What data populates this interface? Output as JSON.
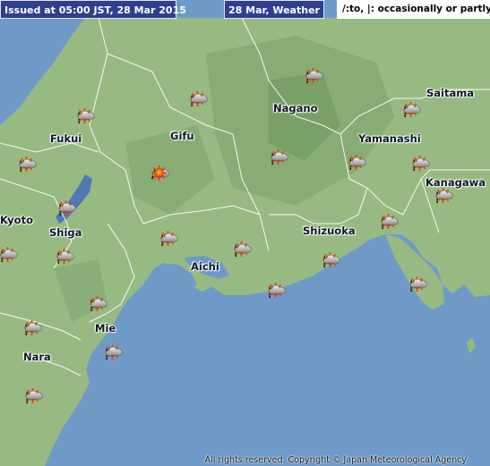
{
  "header": {
    "issued": "Issued at 05:00 JST, 28 Mar 2015",
    "forecast_date": "28 Mar, Weather",
    "legend": "/:to,  |: occasionally or partly"
  },
  "colors": {
    "sea": "#6f9ac8",
    "land": "#97ba82",
    "mountain": "#7ea36c",
    "lake": "#4f79b5",
    "banner": "#2e3f8f"
  },
  "prefectures": {
    "fukui": "Fukui",
    "gifu": "Gifu",
    "nagano": "Nagano",
    "saitama": "Saitama",
    "yamanashi": "Yamanashi",
    "kanagawa": "Kanagawa",
    "kyoto": "Kyoto",
    "shiga": "Shiga",
    "aichi": "Aichi",
    "shizuoka": "Shizuoka",
    "mie": "Mie",
    "nara": "Nara"
  },
  "forecasts": [
    {
      "first": "sun-icon",
      "sep": "|",
      "second": "cloud-icon"
    },
    {
      "first": "sun-icon",
      "sep": "|",
      "second": "cloud-icon"
    },
    {
      "first": "sun-icon",
      "sep": "|",
      "second": "cloud-icon"
    },
    {
      "first": "sun-icon",
      "sep": "|",
      "second": "cloud-icon"
    },
    {
      "first": "sun-icon",
      "sep": "|",
      "second": "cloud-icon"
    },
    {
      "first": "cloud-icon",
      "sep": "/",
      "second": "sun-icon"
    },
    {
      "first": "sun-icon",
      "sep": "|",
      "second": "cloud-icon"
    },
    {
      "first": "sun-icon",
      "sep": "|",
      "second": "cloud-icon"
    },
    {
      "first": "sun-icon",
      "sep": "|",
      "second": "cloud-icon"
    },
    {
      "first": "sun-icon",
      "sep": "|",
      "second": "cloud-icon"
    },
    {
      "first": "sun-icon",
      "sep": "|",
      "second": "cloud-icon"
    },
    {
      "first": "sun-icon",
      "sep": "|",
      "second": "cloud-icon"
    },
    {
      "first": "sun-icon",
      "sep": "|",
      "second": "cloud-icon"
    },
    {
      "first": "sun-icon",
      "sep": "|",
      "second": "cloud-icon"
    },
    {
      "first": "sun-icon",
      "sep": "|",
      "second": "cloud-icon"
    },
    {
      "first": "sun-icon",
      "sep": "|",
      "second": "cloud-icon"
    },
    {
      "first": "sun-icon",
      "sep": "|",
      "second": "cloud-icon"
    },
    {
      "first": "sun-icon",
      "sep": "|",
      "second": "cloud-icon"
    },
    {
      "first": "sun-icon",
      "sep": "|",
      "second": "cloud-icon"
    },
    {
      "first": "sun-icon",
      "sep": "|",
      "second": "cloud-icon"
    },
    {
      "first": "sun-icon",
      "sep": "|",
      "second": "cloud-icon"
    },
    {
      "first": "sun-icon",
      "sep": "|",
      "second": "cloud-icon"
    },
    {
      "first": "sun-icon",
      "sep": "|",
      "second": "cloud-icon"
    },
    {
      "first": "sun-icon",
      "sep": "|",
      "second": "cloud-icon"
    },
    {
      "first": "sun-icon",
      "sep": "|",
      "second": "cloud-icon"
    }
  ],
  "footer": {
    "copyright": "All rights reserved. Copyright © Japan Meteorological Agency"
  }
}
